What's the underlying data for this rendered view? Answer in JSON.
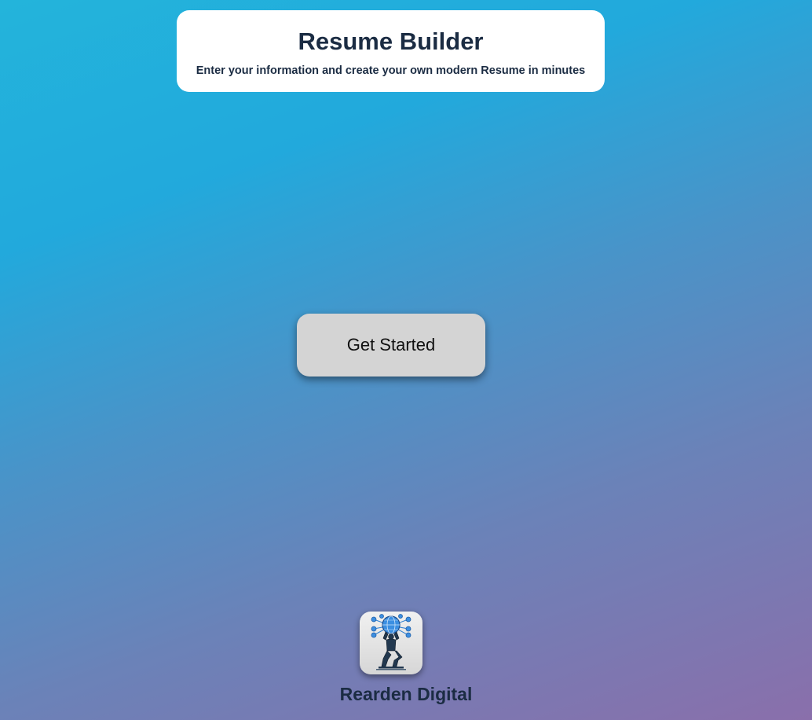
{
  "header": {
    "title": "Resume Builder",
    "subtitle": "Enter your information and create your own modern Resume in minutes"
  },
  "main": {
    "cta_label": "Get Started"
  },
  "footer": {
    "logo_icon": "atlas-globe-logo-icon",
    "brand_name": "Rearden Digital"
  },
  "colors": {
    "gradient_start": "#23b4db",
    "gradient_end": "#8a6fab",
    "heading_text": "#1b2c43",
    "button_bg": "#d4d4d4"
  }
}
